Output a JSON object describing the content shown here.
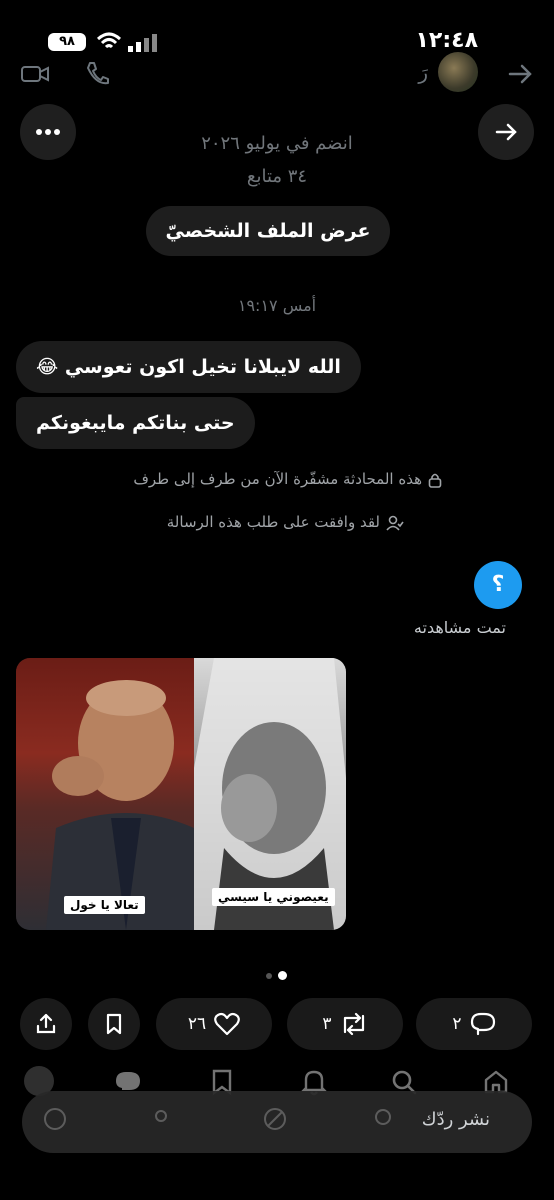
{
  "status_bar": {
    "time": "١٢:٤٨",
    "battery": "٩٨"
  },
  "header": {
    "name": "رَ"
  },
  "profile": {
    "joined": "انضم في يوليو ٢٠٢٦",
    "followers": "٣٤ متابع",
    "view_profile_label": "عرض الملف الشخصيّ"
  },
  "conversation": {
    "timestamp": "أمس ١٩:١٧",
    "messages": [
      {
        "text": "الله لايبلانا تخيل اكون تعوسي 😂"
      },
      {
        "text": "حتى بناتكم مايبغونكم"
      }
    ],
    "encrypted_notice": "هذه المحادثة مشفّرة الآن من طرف إلى طرف",
    "accepted_notice": "لقد وافقت على طلب هذه الرسالة",
    "sent_message": "؟",
    "seen_label": "تمت مشاهدته"
  },
  "media": {
    "caption_left": "تعالا يا خول",
    "caption_right": "يعيصوني يا سيسي"
  },
  "actions": {
    "likes": "٢٦",
    "reposts": "٣",
    "replies": "٢"
  },
  "reply_box": {
    "placeholder": "نشر ردّك"
  },
  "colors": {
    "accent": "#1d9bf0",
    "background": "#000000",
    "bubble": "#1c1c1c"
  }
}
